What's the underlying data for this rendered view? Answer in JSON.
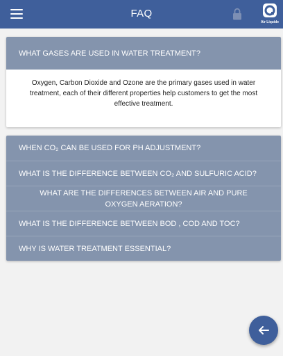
{
  "appbar": {
    "title": "FAQ",
    "logo_text": "Air Liquide",
    "color": "#3f5f9b"
  },
  "icons": {
    "menu": "hamburger-menu-icon",
    "lock": "lock-icon",
    "fab": "arrow-left-icon"
  },
  "faq": {
    "open": {
      "question": "WHAT GASES ARE USED IN WATER TREATMENT?",
      "answer": "Oxygen, Carbon Dioxide and Ozone are the primary gases used in water treatment, each of their different properties help customers to get the most effective treatment."
    },
    "items": [
      "WHEN CO₂ CAN BE USED FOR PH ADJUSTMENT?",
      "WHAT IS THE DIFFERENCE BETWEEN CO₂ AND SULFURIC ACID?",
      "WHAT ARE THE DIFFERENCES BETWEEN AIR AND PURE OXYGEN AERATION?",
      "WHAT IS THE DIFFERENCE BETWEEN BOD , COD AND TOC?",
      "WHY IS WATER TREATMENT ESSENTIAL?"
    ],
    "header_color": "#8494ad"
  }
}
